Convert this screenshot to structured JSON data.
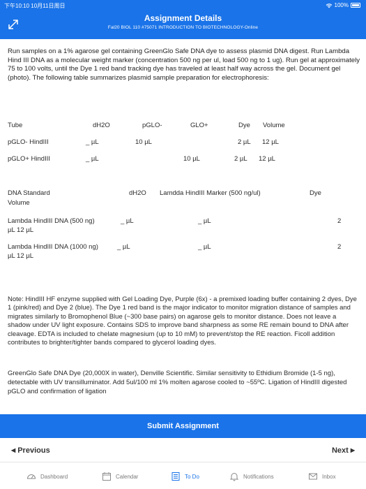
{
  "status": {
    "time": "下午10:10  10月11日周日",
    "battery": "100%"
  },
  "header": {
    "title": "Assignment Details",
    "subtitle": "Fal20 BIOL 110 #75071 INTRODUCTION TO BIOTECHNOLOGY-Online"
  },
  "intro": "Run samples on a 1% agarose gel containing GreenGlo Safe DNA dye to assess plasmid DNA digest. Run Lambda Hind III DNA as a molecular weight marker (concentration 500 ng per ul, load 500 ng to 1 ug).  Run gel at approximately 75 to 100 volts, until the Dye 1 red band tracking dye has traveled at least half way across the gel.  Document gel (photo).  The following table summarizes plasmid sample preparation for electrophoresis:",
  "table1": {
    "headers": [
      "Tube",
      "dH2O",
      "pGLO-",
      "GLO+",
      "Dye",
      "Volume"
    ],
    "rows": [
      [
        "pGLO- HindIII",
        "_ µL",
        "10 µL",
        "",
        "2 µL",
        "12 µL"
      ],
      [
        "pGLO+ HindIII",
        "_ µL",
        "",
        "10 µL",
        "2 µL",
        "12 µL"
      ]
    ]
  },
  "table2": {
    "header_a": "DNA Standard",
    "header_b": "dH2O",
    "header_c": "Lamdda HindIII Marker (500 ng/ul)",
    "header_d": "Dye",
    "header_e": "Volume",
    "rows": [
      {
        "name": "Lambda HindIII DNA  (500 ng)",
        "dh2o": "_ µL",
        "marker": "_ µL",
        "dye": "2",
        "volume": "µL   12 µL"
      },
      {
        "name": "Lambda HindIII DNA (1000 ng)",
        "dh2o": "_ µL",
        "marker": "_ µL",
        "dye": "2",
        "volume": "µL   12 µL"
      }
    ]
  },
  "note": "Note: HindIII HF enzyme supplied with Gel Loading Dye, Purple (6x) - a premixed loading buffer containing 2 dyes, Dye 1 (pink/red) and Dye 2 (blue).  The Dye 1 red band is the major indicator to monitor migration distance of samples and migrates similarly to Bromophenol Blue (~300 base pairs) on agarose gels to monitor distance.  Does not leave a shadow under UV light exposure.  Contains SDS to improve band sharpness as some RE remain bound to DNA after cleavage.  EDTA is included to chelate magnesium (up to 10 mM) to prevent/stop the RE reaction.  Ficoll addition contributes to brighter/tighter bands compared to glycerol loading dyes.",
  "note2": "GreenGlo Safe DNA Dye (20,000X in water), Denville Scientific. Similar sensitivity to Ethidium Bromide (1-5 ng), detectable with UV transilluminator. Add 5ul/100 ml 1% molten agarose cooled to ~55ºC. Ligation of HindIII digested pGLO and confirmation of ligation",
  "submit_label": "Submit Assignment",
  "pager": {
    "previous": "Previous",
    "next": "Next"
  },
  "tabs": [
    {
      "label": "Dashboard",
      "icon": "dashboard-icon"
    },
    {
      "label": "Calendar",
      "icon": "calendar-icon"
    },
    {
      "label": "To Do",
      "icon": "todo-icon"
    },
    {
      "label": "Notifications",
      "icon": "bell-icon"
    },
    {
      "label": "Inbox",
      "icon": "inbox-icon"
    }
  ],
  "colors": {
    "accent": "#1a73e8",
    "text": "#2a2a2a",
    "tab_inactive": "#7a7a7a"
  }
}
